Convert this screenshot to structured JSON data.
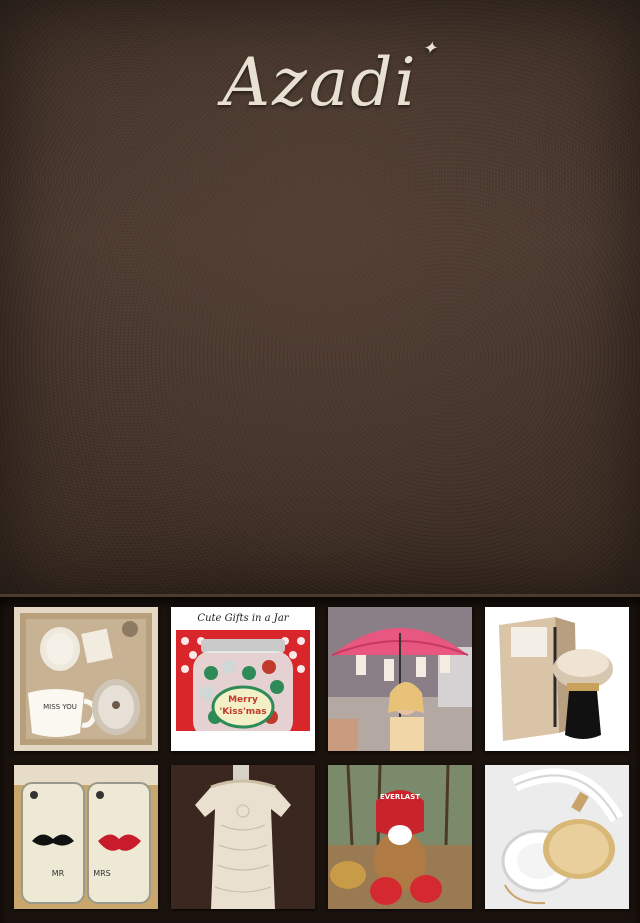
{
  "app": {
    "logo_text": "Azadi"
  },
  "tiles": [
    {
      "id": "gift-box-mugs",
      "caption": "MISS YOU"
    },
    {
      "id": "gifts-in-jar",
      "caption_top": "Cute Gifts in a Jar",
      "label_line1": "Merry",
      "label_line2": "'Kiss'mas"
    },
    {
      "id": "umbrella-girl"
    },
    {
      "id": "shaving-brush"
    },
    {
      "id": "mr-mrs-phone-cases",
      "left_label": "MR",
      "right_label": "MRS"
    },
    {
      "id": "lace-dress"
    },
    {
      "id": "boxer-dog",
      "headgear_text": "EVERLAST"
    },
    {
      "id": "white-gold-headphones"
    }
  ],
  "colors": {
    "leather": "#3e2e24",
    "logo": "#e8e1d2",
    "grid_bg": "#1a120d"
  }
}
